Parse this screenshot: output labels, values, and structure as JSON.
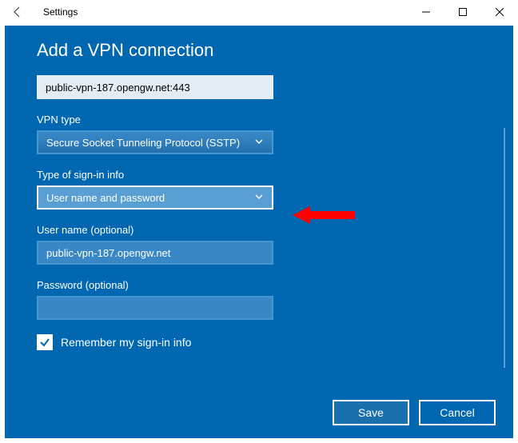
{
  "titlebar": {
    "title": "Settings"
  },
  "dialog": {
    "title": "Add a VPN connection",
    "server": {
      "value": "public-vpn-187.opengw.net:443"
    },
    "vpntype": {
      "label": "VPN type",
      "value": "Secure Socket Tunneling Protocol (SSTP)"
    },
    "signin": {
      "label": "Type of sign-in info",
      "value": "User name and password"
    },
    "username": {
      "label": "User name (optional)",
      "value": "public-vpn-187.opengw.net"
    },
    "password": {
      "label": "Password (optional)",
      "value": ""
    },
    "remember": {
      "label": "Remember my sign-in info",
      "checked": true
    },
    "buttons": {
      "save": "Save",
      "cancel": "Cancel"
    }
  }
}
